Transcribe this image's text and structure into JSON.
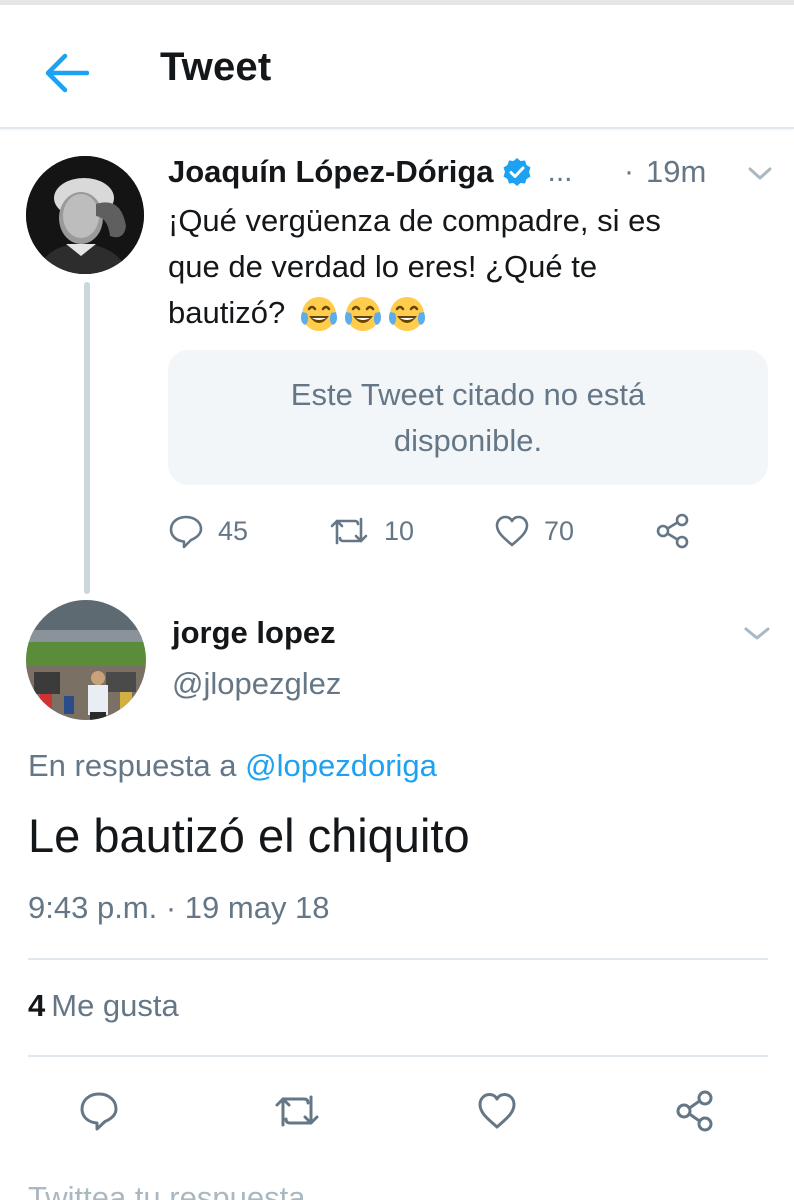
{
  "header": {
    "title": "Tweet",
    "back_icon": "back-arrow-icon",
    "accent_color": "#1da1f2"
  },
  "parent_tweet": {
    "author_name": "Joaquín López-Dóriga",
    "verified": true,
    "ellipsis": "...",
    "separator": "·",
    "time": "19m",
    "text_line_1": "¡Qué vergüenza de compadre, si es",
    "text_line_2": "que de verdad lo eres! ¿Qué te",
    "text_line_3": "bautizó?",
    "emojis": [
      "face-with-tears-of-joy-icon",
      "face-with-tears-of-joy-icon",
      "face-with-tears-of-joy-icon"
    ],
    "quoted_unavailable": "Este Tweet citado no está disponible.",
    "replies": "45",
    "retweets": "10",
    "likes": "70"
  },
  "main_tweet": {
    "author_name": "jorge lopez",
    "handle": "@jlopezglez",
    "reply_prefix": "En respuesta a",
    "reply_handle": "@lopezdoriga",
    "text": "Le bautizó el chiquito",
    "timestamp": "9:43 p.m. · 19 may 18",
    "likes_count": "4",
    "likes_label": "Me gusta"
  },
  "reply_box": {
    "placeholder": "Twittea tu respuesta"
  },
  "colors": {
    "text_primary": "#14171a",
    "text_secondary": "#657786",
    "divider": "#e1e8ed",
    "link": "#1da1f2",
    "thread_line": "#ccd6dd"
  }
}
